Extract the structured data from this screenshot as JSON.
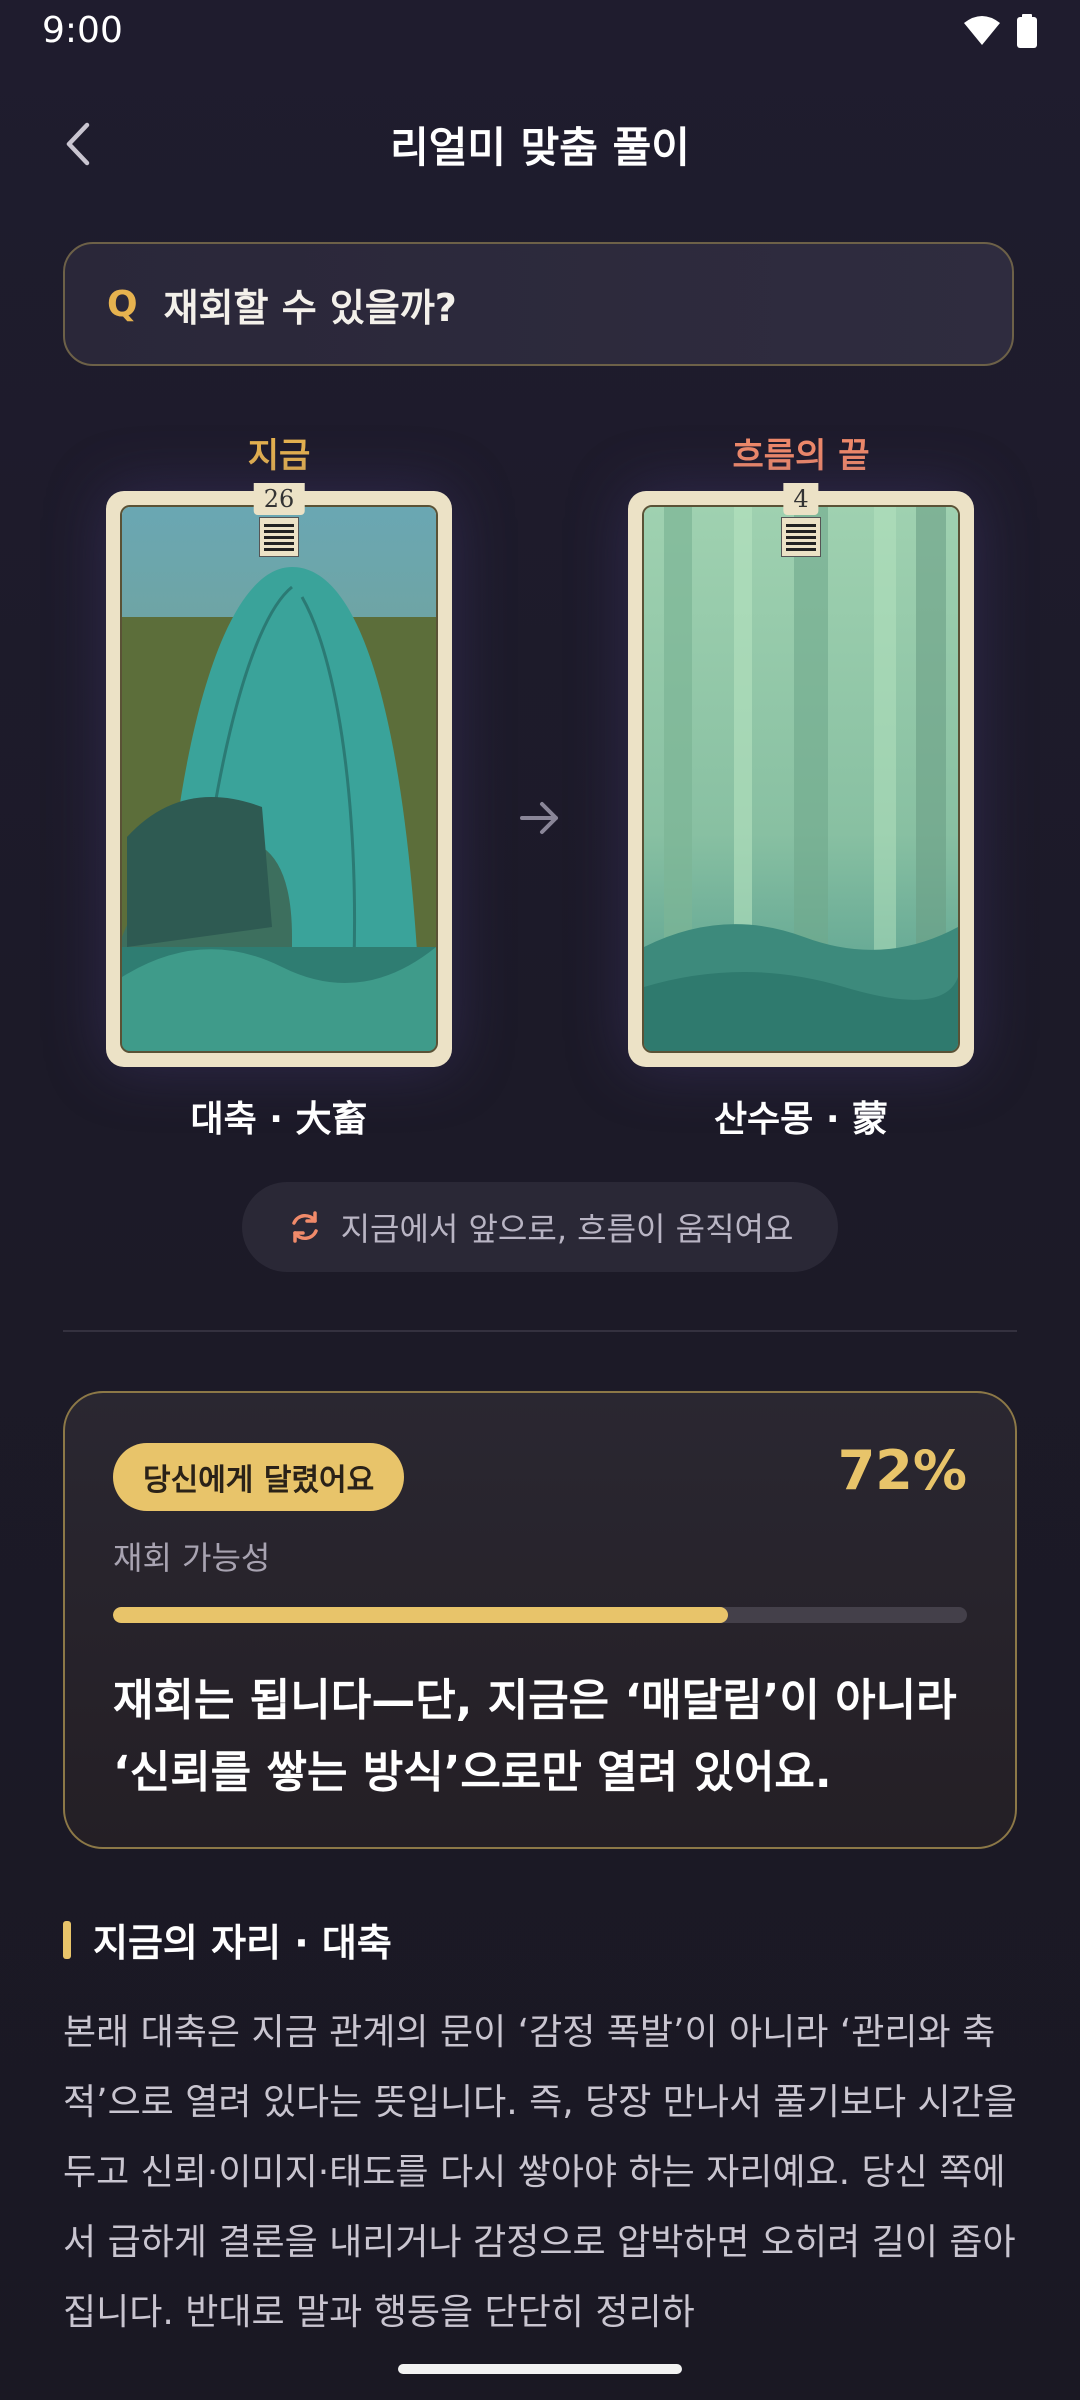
{
  "status_bar": {
    "time": "9:00"
  },
  "header": {
    "title": "리얼미 맞춤 풀이"
  },
  "question": {
    "prefix": "Q",
    "text": "재회할 수 있을까?"
  },
  "cards": {
    "now": {
      "label": "지금",
      "number": "26",
      "name": "대축 · 大畜",
      "label_color": "#e6b24f"
    },
    "end": {
      "label": "흐름의 끝",
      "number": "4",
      "name": "산수몽 · 蒙",
      "label_color": "#f08a6a"
    }
  },
  "flow": {
    "text": "지금에서 앞으로, 흐름이 움직여요"
  },
  "result": {
    "badge": "당신에게 달렸어요",
    "percent_text": "72%",
    "probability_label": "재회 가능성",
    "progress": 0.72,
    "verdict": "재회는 됩니다—단, 지금은 ‘매달림’이 아니라 ‘신뢰를 쌓는 방식’으로만 열려 있어요."
  },
  "section": {
    "title": "지금의 자리 · 대축",
    "body": "본래 대축은 지금 관계의 문이 ‘감정 폭발’이 아니라 ‘관리와 축적’으로 열려 있다는 뜻입니다. 즉, 당장 만나서 풀기보다 시간을 두고 신뢰·이미지·태도를 다시 쌓아야 하는 자리예요. 당신 쪽에서 급하게 결론을 내리거나 감정으로 압박하면 오히려 길이 좁아집니다. 반대로 말과 행동을 단단히 정리하"
  },
  "colors": {
    "accent": "#e8c46a",
    "coral": "#f08a6a",
    "background": "#1e1b2b"
  }
}
